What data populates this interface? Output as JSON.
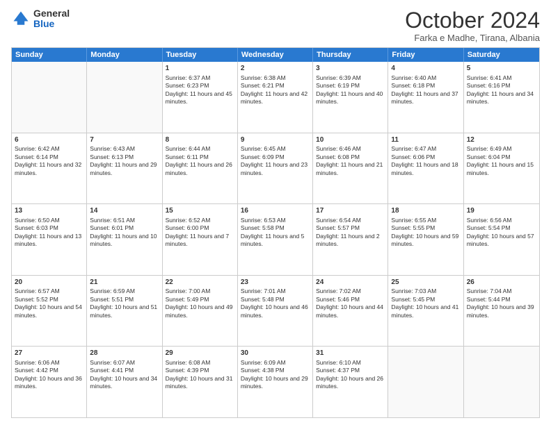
{
  "logo": {
    "general": "General",
    "blue": "Blue"
  },
  "title": "October 2024",
  "subtitle": "Farka e Madhe, Tirana, Albania",
  "days": [
    "Sunday",
    "Monday",
    "Tuesday",
    "Wednesday",
    "Thursday",
    "Friday",
    "Saturday"
  ],
  "rows": [
    [
      {
        "day": "",
        "empty": true
      },
      {
        "day": "",
        "empty": true
      },
      {
        "day": "1",
        "sunrise": "Sunrise: 6:37 AM",
        "sunset": "Sunset: 6:23 PM",
        "daylight": "Daylight: 11 hours and 45 minutes."
      },
      {
        "day": "2",
        "sunrise": "Sunrise: 6:38 AM",
        "sunset": "Sunset: 6:21 PM",
        "daylight": "Daylight: 11 hours and 42 minutes."
      },
      {
        "day": "3",
        "sunrise": "Sunrise: 6:39 AM",
        "sunset": "Sunset: 6:19 PM",
        "daylight": "Daylight: 11 hours and 40 minutes."
      },
      {
        "day": "4",
        "sunrise": "Sunrise: 6:40 AM",
        "sunset": "Sunset: 6:18 PM",
        "daylight": "Daylight: 11 hours and 37 minutes."
      },
      {
        "day": "5",
        "sunrise": "Sunrise: 6:41 AM",
        "sunset": "Sunset: 6:16 PM",
        "daylight": "Daylight: 11 hours and 34 minutes."
      }
    ],
    [
      {
        "day": "6",
        "sunrise": "Sunrise: 6:42 AM",
        "sunset": "Sunset: 6:14 PM",
        "daylight": "Daylight: 11 hours and 32 minutes."
      },
      {
        "day": "7",
        "sunrise": "Sunrise: 6:43 AM",
        "sunset": "Sunset: 6:13 PM",
        "daylight": "Daylight: 11 hours and 29 minutes."
      },
      {
        "day": "8",
        "sunrise": "Sunrise: 6:44 AM",
        "sunset": "Sunset: 6:11 PM",
        "daylight": "Daylight: 11 hours and 26 minutes."
      },
      {
        "day": "9",
        "sunrise": "Sunrise: 6:45 AM",
        "sunset": "Sunset: 6:09 PM",
        "daylight": "Daylight: 11 hours and 23 minutes."
      },
      {
        "day": "10",
        "sunrise": "Sunrise: 6:46 AM",
        "sunset": "Sunset: 6:08 PM",
        "daylight": "Daylight: 11 hours and 21 minutes."
      },
      {
        "day": "11",
        "sunrise": "Sunrise: 6:47 AM",
        "sunset": "Sunset: 6:06 PM",
        "daylight": "Daylight: 11 hours and 18 minutes."
      },
      {
        "day": "12",
        "sunrise": "Sunrise: 6:49 AM",
        "sunset": "Sunset: 6:04 PM",
        "daylight": "Daylight: 11 hours and 15 minutes."
      }
    ],
    [
      {
        "day": "13",
        "sunrise": "Sunrise: 6:50 AM",
        "sunset": "Sunset: 6:03 PM",
        "daylight": "Daylight: 11 hours and 13 minutes."
      },
      {
        "day": "14",
        "sunrise": "Sunrise: 6:51 AM",
        "sunset": "Sunset: 6:01 PM",
        "daylight": "Daylight: 11 hours and 10 minutes."
      },
      {
        "day": "15",
        "sunrise": "Sunrise: 6:52 AM",
        "sunset": "Sunset: 6:00 PM",
        "daylight": "Daylight: 11 hours and 7 minutes."
      },
      {
        "day": "16",
        "sunrise": "Sunrise: 6:53 AM",
        "sunset": "Sunset: 5:58 PM",
        "daylight": "Daylight: 11 hours and 5 minutes."
      },
      {
        "day": "17",
        "sunrise": "Sunrise: 6:54 AM",
        "sunset": "Sunset: 5:57 PM",
        "daylight": "Daylight: 11 hours and 2 minutes."
      },
      {
        "day": "18",
        "sunrise": "Sunrise: 6:55 AM",
        "sunset": "Sunset: 5:55 PM",
        "daylight": "Daylight: 10 hours and 59 minutes."
      },
      {
        "day": "19",
        "sunrise": "Sunrise: 6:56 AM",
        "sunset": "Sunset: 5:54 PM",
        "daylight": "Daylight: 10 hours and 57 minutes."
      }
    ],
    [
      {
        "day": "20",
        "sunrise": "Sunrise: 6:57 AM",
        "sunset": "Sunset: 5:52 PM",
        "daylight": "Daylight: 10 hours and 54 minutes."
      },
      {
        "day": "21",
        "sunrise": "Sunrise: 6:59 AM",
        "sunset": "Sunset: 5:51 PM",
        "daylight": "Daylight: 10 hours and 51 minutes."
      },
      {
        "day": "22",
        "sunrise": "Sunrise: 7:00 AM",
        "sunset": "Sunset: 5:49 PM",
        "daylight": "Daylight: 10 hours and 49 minutes."
      },
      {
        "day": "23",
        "sunrise": "Sunrise: 7:01 AM",
        "sunset": "Sunset: 5:48 PM",
        "daylight": "Daylight: 10 hours and 46 minutes."
      },
      {
        "day": "24",
        "sunrise": "Sunrise: 7:02 AM",
        "sunset": "Sunset: 5:46 PM",
        "daylight": "Daylight: 10 hours and 44 minutes."
      },
      {
        "day": "25",
        "sunrise": "Sunrise: 7:03 AM",
        "sunset": "Sunset: 5:45 PM",
        "daylight": "Daylight: 10 hours and 41 minutes."
      },
      {
        "day": "26",
        "sunrise": "Sunrise: 7:04 AM",
        "sunset": "Sunset: 5:44 PM",
        "daylight": "Daylight: 10 hours and 39 minutes."
      }
    ],
    [
      {
        "day": "27",
        "sunrise": "Sunrise: 6:06 AM",
        "sunset": "Sunset: 4:42 PM",
        "daylight": "Daylight: 10 hours and 36 minutes."
      },
      {
        "day": "28",
        "sunrise": "Sunrise: 6:07 AM",
        "sunset": "Sunset: 4:41 PM",
        "daylight": "Daylight: 10 hours and 34 minutes."
      },
      {
        "day": "29",
        "sunrise": "Sunrise: 6:08 AM",
        "sunset": "Sunset: 4:39 PM",
        "daylight": "Daylight: 10 hours and 31 minutes."
      },
      {
        "day": "30",
        "sunrise": "Sunrise: 6:09 AM",
        "sunset": "Sunset: 4:38 PM",
        "daylight": "Daylight: 10 hours and 29 minutes."
      },
      {
        "day": "31",
        "sunrise": "Sunrise: 6:10 AM",
        "sunset": "Sunset: 4:37 PM",
        "daylight": "Daylight: 10 hours and 26 minutes."
      },
      {
        "day": "",
        "empty": true
      },
      {
        "day": "",
        "empty": true
      }
    ]
  ]
}
